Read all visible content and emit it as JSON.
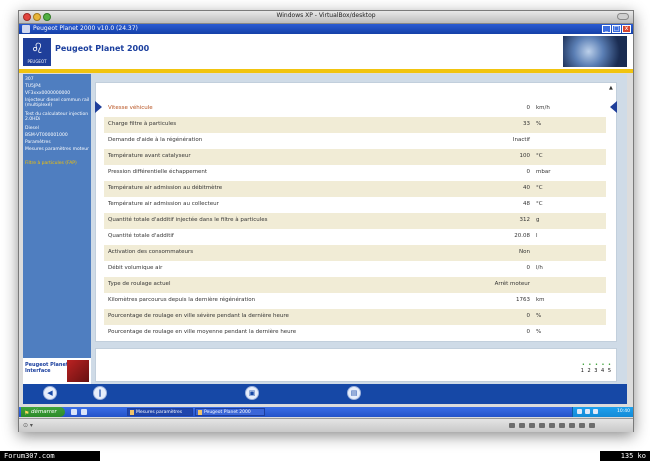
{
  "mac_window": {
    "title": "Windows XP - VirtualBox/desktop"
  },
  "app_window": {
    "title": "Peugeot Planet 2000 v10.0 (24.37)",
    "minimize": "_",
    "maximize": "□",
    "close": "x"
  },
  "header": {
    "logo_text": "PEUGEOT",
    "app_name": "Peugeot Planet 2000"
  },
  "sidebar": {
    "items": [
      {
        "label": "307"
      },
      {
        "label": "TU5JP4"
      },
      {
        "label": "VF3xxx0000000000"
      },
      {
        "label": "Injecteur diesel commun rail (multiplexé)"
      },
      {
        "label": "Test du calculateur injection 2.0HDi"
      },
      {
        "label": "Diesel"
      },
      {
        "label": "BSM-VT000001000"
      },
      {
        "label": "Paramètres"
      },
      {
        "label": "Mesures paramètres moteur"
      },
      {
        "label": "Filtre à particules (FAP)",
        "active": true
      }
    ],
    "footer_text": "Peugeot Planet Interface"
  },
  "table": {
    "rows": [
      {
        "label": "Vitesse véhicule",
        "value": "0",
        "unit": "km/h"
      },
      {
        "label": "Charge filtre à particules",
        "value": "33",
        "unit": "%"
      },
      {
        "label": "Demande d'aide à la régénération",
        "value": "Inactif",
        "unit": ""
      },
      {
        "label": "Température avant catalyseur",
        "value": "100",
        "unit": "°C"
      },
      {
        "label": "Pression différentielle échappement",
        "value": "0",
        "unit": "mbar"
      },
      {
        "label": "Température air admission au débitmètre",
        "value": "40",
        "unit": "°C"
      },
      {
        "label": "Température air admission au collecteur",
        "value": "48",
        "unit": "°C"
      },
      {
        "label": "Quantité totale d'additif injectée dans le filtre à particules",
        "value": "312",
        "unit": "g"
      },
      {
        "label": "Quantité totale d'additif",
        "value": "20.08",
        "unit": "l"
      },
      {
        "label": "Activation des consommateurs",
        "value": "Non",
        "unit": ""
      },
      {
        "label": "Débit volumique air",
        "value": "0",
        "unit": "l/h"
      },
      {
        "label": "Type de roulage actuel",
        "value": "Arrêt moteur",
        "unit": ""
      },
      {
        "label": "Kilomètres parcourus depuis la dernière régénération",
        "value": "1763",
        "unit": "km"
      },
      {
        "label": "Pourcentage de roulage en ville sévère pendant la dernière heure",
        "value": "0",
        "unit": "%"
      },
      {
        "label": "Pourcentage de roulage en ville moyenne pendant la dernière heure",
        "value": "0",
        "unit": "%"
      }
    ]
  },
  "pager": {
    "pages": "1 2 3 4 5",
    "dots": "• • • • •"
  },
  "toolbar": {
    "buttons": [
      {
        "icon": "back-icon",
        "glyph": "◀"
      },
      {
        "icon": "pause-icon",
        "glyph": "‖"
      },
      {
        "icon": "save-icon",
        "glyph": "▣"
      },
      {
        "icon": "print-icon",
        "glyph": "▤"
      }
    ]
  },
  "taskbar": {
    "start_label": "démarrer",
    "tasks": [
      {
        "label": "Mesures paramètres"
      },
      {
        "label": "Peugeot Planet 2000"
      }
    ],
    "clock": "10:40"
  },
  "watermark": {
    "left": "Forum307.com",
    "right": "135 ko"
  },
  "colors": {
    "accent_blue": "#1648a6",
    "sidebar_blue": "#4f7ec0",
    "active_nav": "#f6c100",
    "selected_row_text": "#b6501e",
    "row_stripe": "#f1ecd6"
  }
}
